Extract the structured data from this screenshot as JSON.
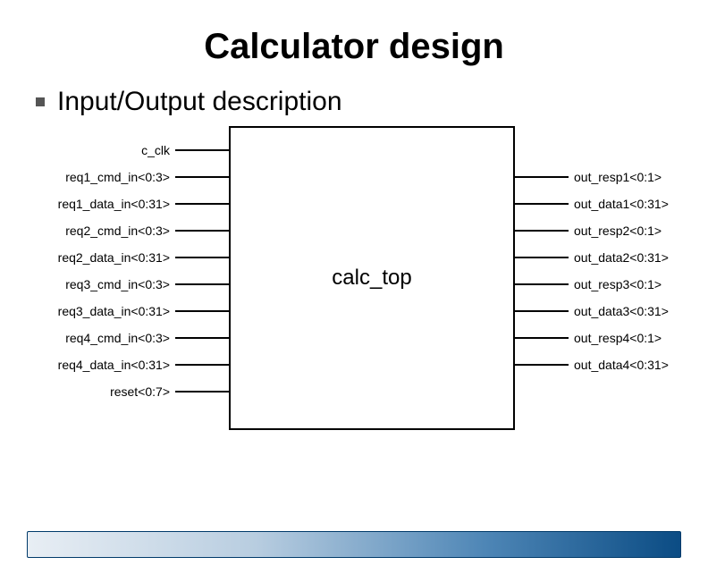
{
  "title": "Calculator design",
  "subtitle": "Input/Output description",
  "block": {
    "label": "calc_top"
  },
  "inputs": [
    {
      "label": "c_clk"
    },
    {
      "label": "req1_cmd_in<0:3>"
    },
    {
      "label": "req1_data_in<0:31>"
    },
    {
      "label": "req2_cmd_in<0:3>"
    },
    {
      "label": "req2_data_in<0:31>"
    },
    {
      "label": "req3_cmd_in<0:3>"
    },
    {
      "label": "req3_data_in<0:31>"
    },
    {
      "label": "req4_cmd_in<0:3>"
    },
    {
      "label": "req4_data_in<0:31>"
    },
    {
      "label": "reset<0:7>"
    }
  ],
  "outputs": [
    {
      "label": "out_resp1<0:1>"
    },
    {
      "label": "out_data1<0:31>"
    },
    {
      "label": "out_resp2<0:1>"
    },
    {
      "label": "out_data2<0:31>"
    },
    {
      "label": "out_resp3<0:1>"
    },
    {
      "label": "out_data3<0:31>"
    },
    {
      "label": "out_resp4<0:1>"
    },
    {
      "label": "out_data4<0:31>"
    }
  ],
  "layout": {
    "input_top_offsets": [
      18,
      48,
      78,
      108,
      138,
      168,
      198,
      228,
      258,
      288
    ],
    "output_top_offsets": [
      48,
      78,
      108,
      138,
      168,
      198,
      228,
      258
    ]
  }
}
